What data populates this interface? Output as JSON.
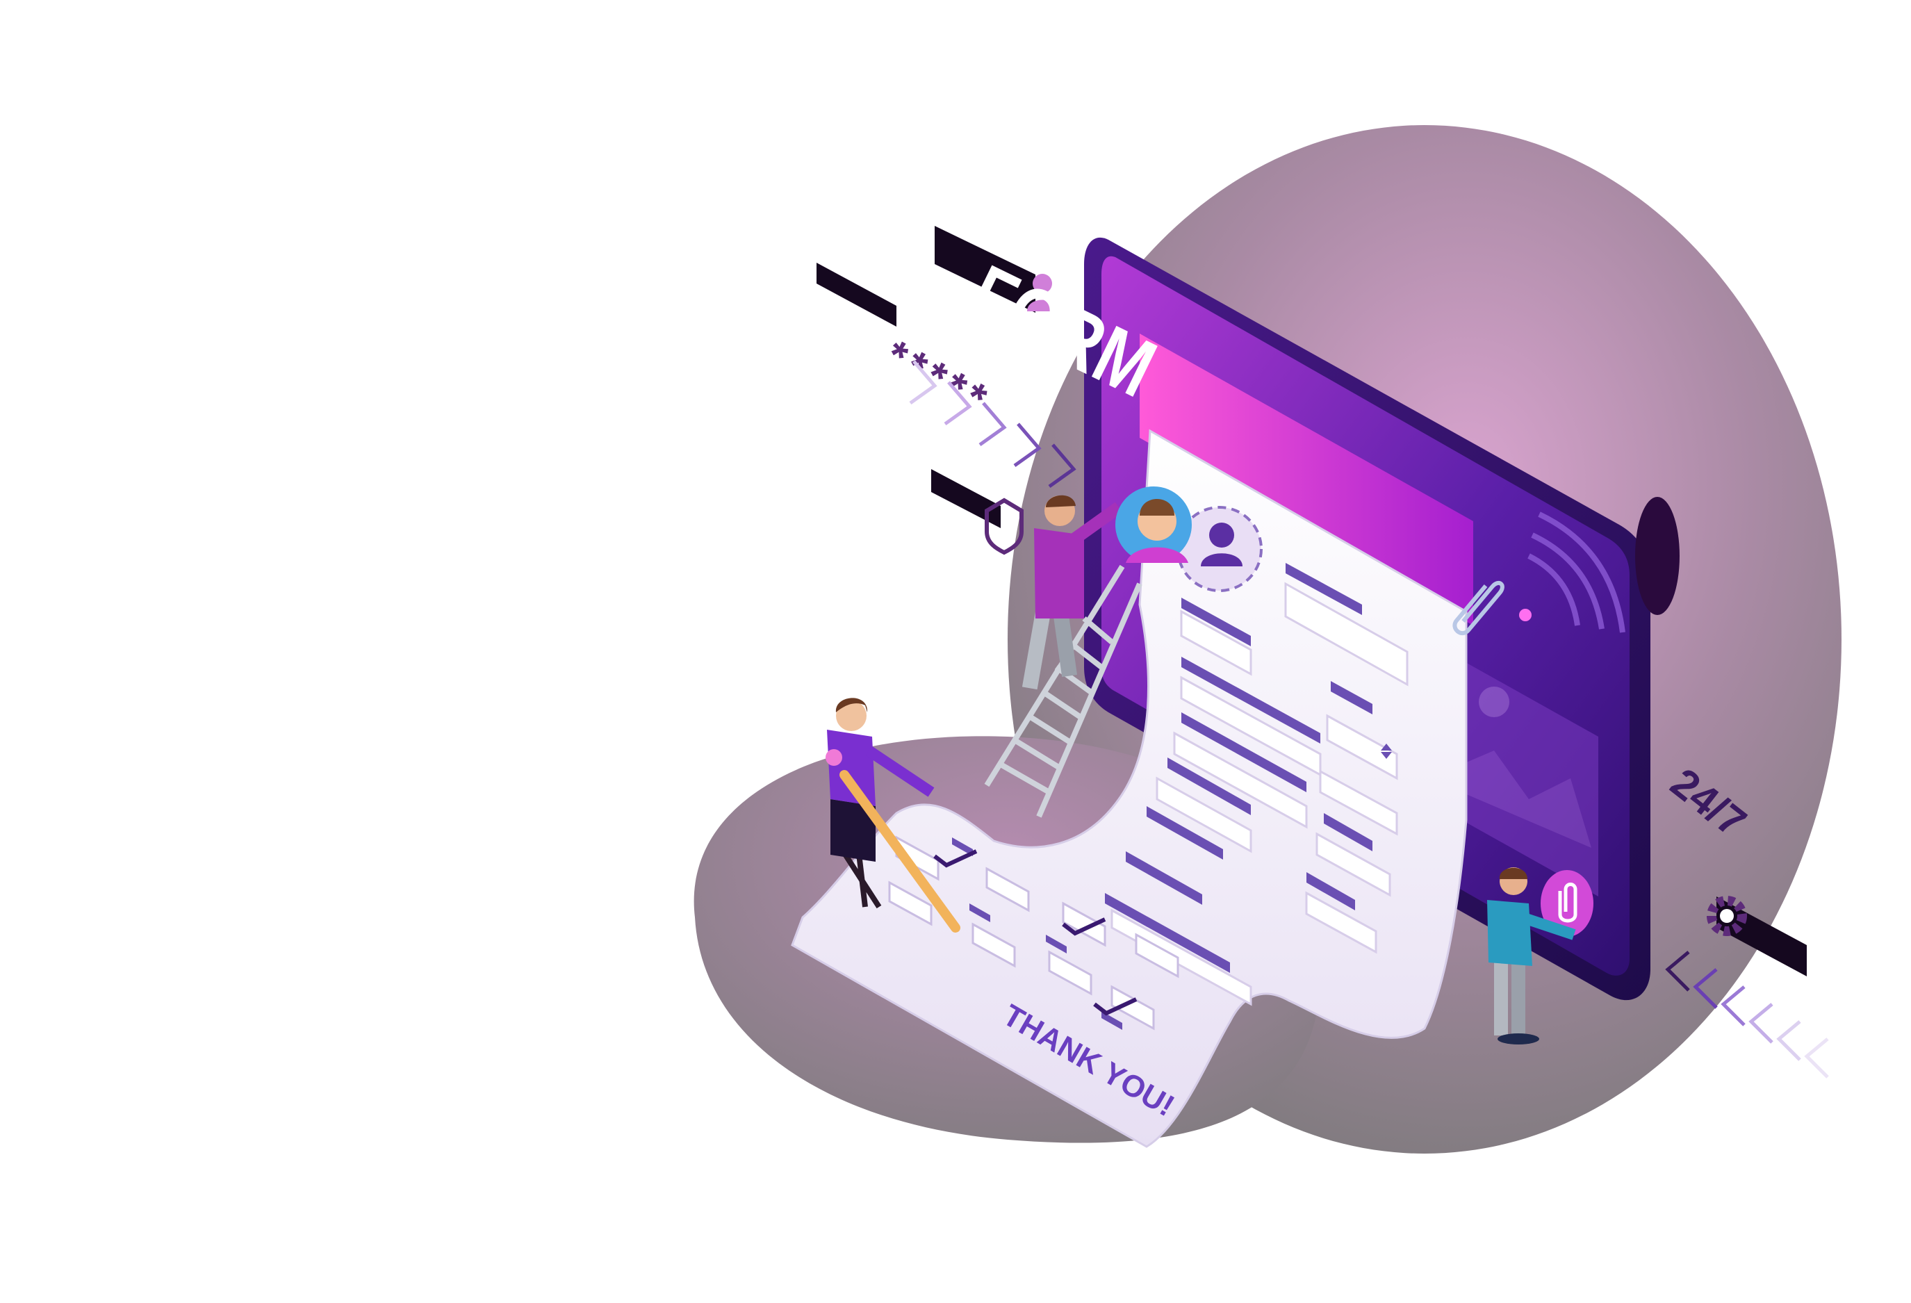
{
  "illustration": {
    "form_title": "FORM",
    "receipt_message": "THANK YOU!",
    "availability_badge": "24/7",
    "password_mask": "*****",
    "icons": [
      "user-icon",
      "shield-icon",
      "paperclip-icon",
      "gear-icon",
      "wifi-signal-icon",
      "image-icon",
      "attachment-icon",
      "chevron-arrows-icon",
      "checkmark-icon"
    ],
    "colors": {
      "accent": "#9b2fc9",
      "magenta": "#e04fd0",
      "deep_purple": "#2a0a3d",
      "blob_gray": "#8a8088",
      "paper": "#f3effa",
      "field_bar": "#6a4fb3",
      "teal_shirt": "#2a9bc0"
    }
  }
}
